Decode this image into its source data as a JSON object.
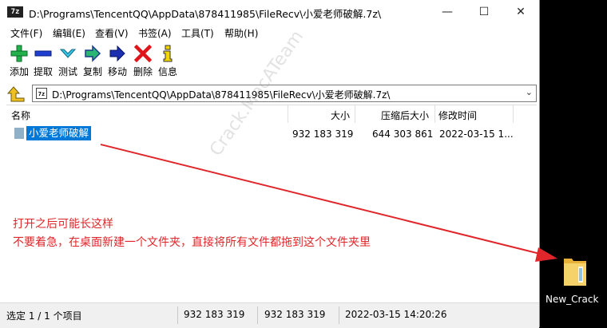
{
  "window": {
    "title": "D:\\Programs\\TencentQQ\\AppData\\878411985\\FileRecv\\小爱老师破解.7z\\",
    "app_icon_text": "7z",
    "controls": {
      "minimize": "—",
      "maximize": "☐",
      "close": "✕"
    }
  },
  "menu": [
    "文件(F)",
    "编辑(E)",
    "查看(V)",
    "书签(A)",
    "工具(T)",
    "帮助(H)"
  ],
  "toolbar": [
    {
      "label": "添加",
      "icon": "add-icon"
    },
    {
      "label": "提取",
      "icon": "extract-icon"
    },
    {
      "label": "测试",
      "icon": "test-icon"
    },
    {
      "label": "复制",
      "icon": "copy-icon"
    },
    {
      "label": "移动",
      "icon": "move-icon"
    },
    {
      "label": "删除",
      "icon": "delete-icon"
    },
    {
      "label": "信息",
      "icon": "info-icon"
    }
  ],
  "address": {
    "icon_text": "7z",
    "path": "D:\\Programs\\TencentQQ\\AppData\\878411985\\FileRecv\\小爱老师破解.7z\\"
  },
  "columns": {
    "name": "名称",
    "size": "大小",
    "packed": "压缩后大小",
    "modified": "修改时间"
  },
  "rows": [
    {
      "name": "小爱老师破解",
      "size": "932 183 319",
      "packed": "644 303 861",
      "modified": "2022-03-15 1..."
    }
  ],
  "annotation": {
    "line1": "打开之后可能长这样",
    "line2": "不要着急，在桌面新建一个文件夹，直接将所有文件都拖到这个文件夹里",
    "watermark": "Crack.MacATeam",
    "arrow_color": "#e0262a"
  },
  "status": {
    "selected": "选定 1 / 1 个项目",
    "size": "932 183 319",
    "packed": "932 183 319",
    "modified": "2022-03-15 14:20:26"
  },
  "desktop": {
    "folder_label": "New_Crack"
  }
}
